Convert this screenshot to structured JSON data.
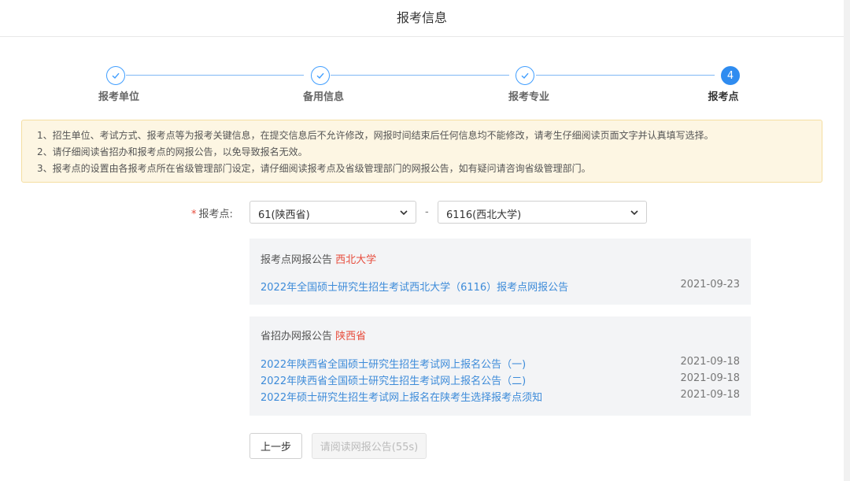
{
  "header": {
    "title": "报考信息"
  },
  "steps": [
    {
      "label": "报考单位",
      "state": "done",
      "icon": "check-icon"
    },
    {
      "label": "备用信息",
      "state": "done",
      "icon": "check-icon"
    },
    {
      "label": "报考专业",
      "state": "done",
      "icon": "check-icon"
    },
    {
      "label": "报考点",
      "state": "active",
      "number": "4"
    }
  ],
  "notice": {
    "lines": [
      "1、招生单位、考试方式、报考点等为报考关键信息，在提交信息后不允许修改，网报时间结束后任何信息均不能修改，请考生仔细阅读页面文字并认真填写选择。",
      "2、请仔细阅读省招办和报考点的网报公告，以免导致报名无效。",
      "3、报考点的设置由各报考点所在省级管理部门设定，请仔细阅读报考点及省级管理部门的网报公告，如有疑问请咨询省级管理部门。"
    ]
  },
  "form": {
    "required_mark": "*",
    "label": "报考点:",
    "province_select": "61(陕西省)",
    "separator": "-",
    "site_select": "6116(西北大学)"
  },
  "site_panel": {
    "title": "报考点网报公告",
    "highlight": "西北大学",
    "items": [
      {
        "text": "2022年全国硕士研究生招生考试西北大学（6116）报考点网报公告",
        "date": "2021-09-23"
      }
    ]
  },
  "province_panel": {
    "title": "省招办网报公告",
    "highlight": "陕西省",
    "items": [
      {
        "text": "2022年陕西省全国硕士研究生招生考试网上报名公告（一)",
        "date": "2021-09-18"
      },
      {
        "text": "2022年陕西省全国硕士研究生招生考试网上报名公告（二)",
        "date": "2021-09-18"
      },
      {
        "text": "2022年硕士研究生招生考试网上报名在陕考生选择报考点须知",
        "date": "2021-09-18"
      }
    ]
  },
  "buttons": {
    "prev": "上一步",
    "read": "请阅读网报公告(55s)"
  },
  "colors": {
    "accent": "#409eff",
    "highlight": "#e74c3c",
    "link": "#3d8bd9",
    "notice_bg": "#fdf6e3"
  }
}
